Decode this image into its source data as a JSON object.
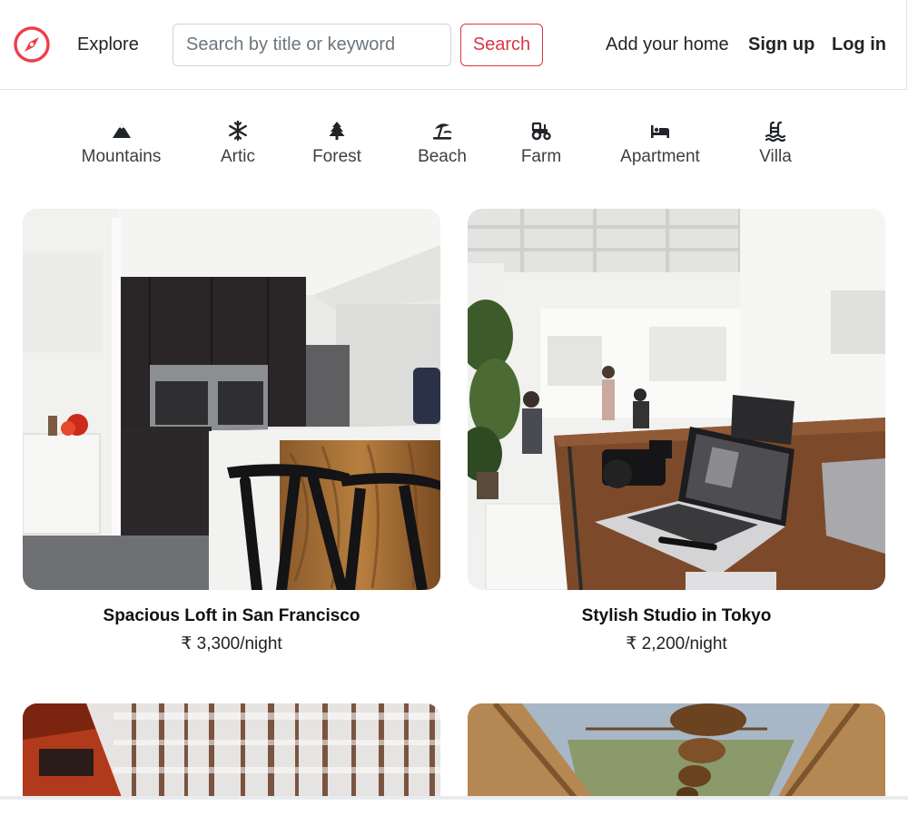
{
  "brand": {
    "accent": "#ef3e4a"
  },
  "nav": {
    "explore": "Explore",
    "search_placeholder": "Search by title or keyword",
    "search_button": "Search",
    "add_home": "Add your home",
    "sign_up": "Sign up",
    "log_in": "Log in"
  },
  "filters": [
    {
      "label": "Mountains",
      "icon": "mountain-icon"
    },
    {
      "label": "Artic",
      "icon": "snowflake-icon"
    },
    {
      "label": "Forest",
      "icon": "tree-icon"
    },
    {
      "label": "Beach",
      "icon": "umbrella-beach-icon"
    },
    {
      "label": "Farm",
      "icon": "tractor-icon"
    },
    {
      "label": "Apartment",
      "icon": "bed-icon"
    },
    {
      "label": "Villa",
      "icon": "pool-icon"
    }
  ],
  "listings": [
    {
      "title": "Spacious Loft in San Francisco",
      "price": "₹ 3,300/night"
    },
    {
      "title": "Stylish Studio in Tokyo",
      "price": "₹ 2,200/night"
    },
    {
      "title": "",
      "price": ""
    },
    {
      "title": "",
      "price": ""
    }
  ]
}
